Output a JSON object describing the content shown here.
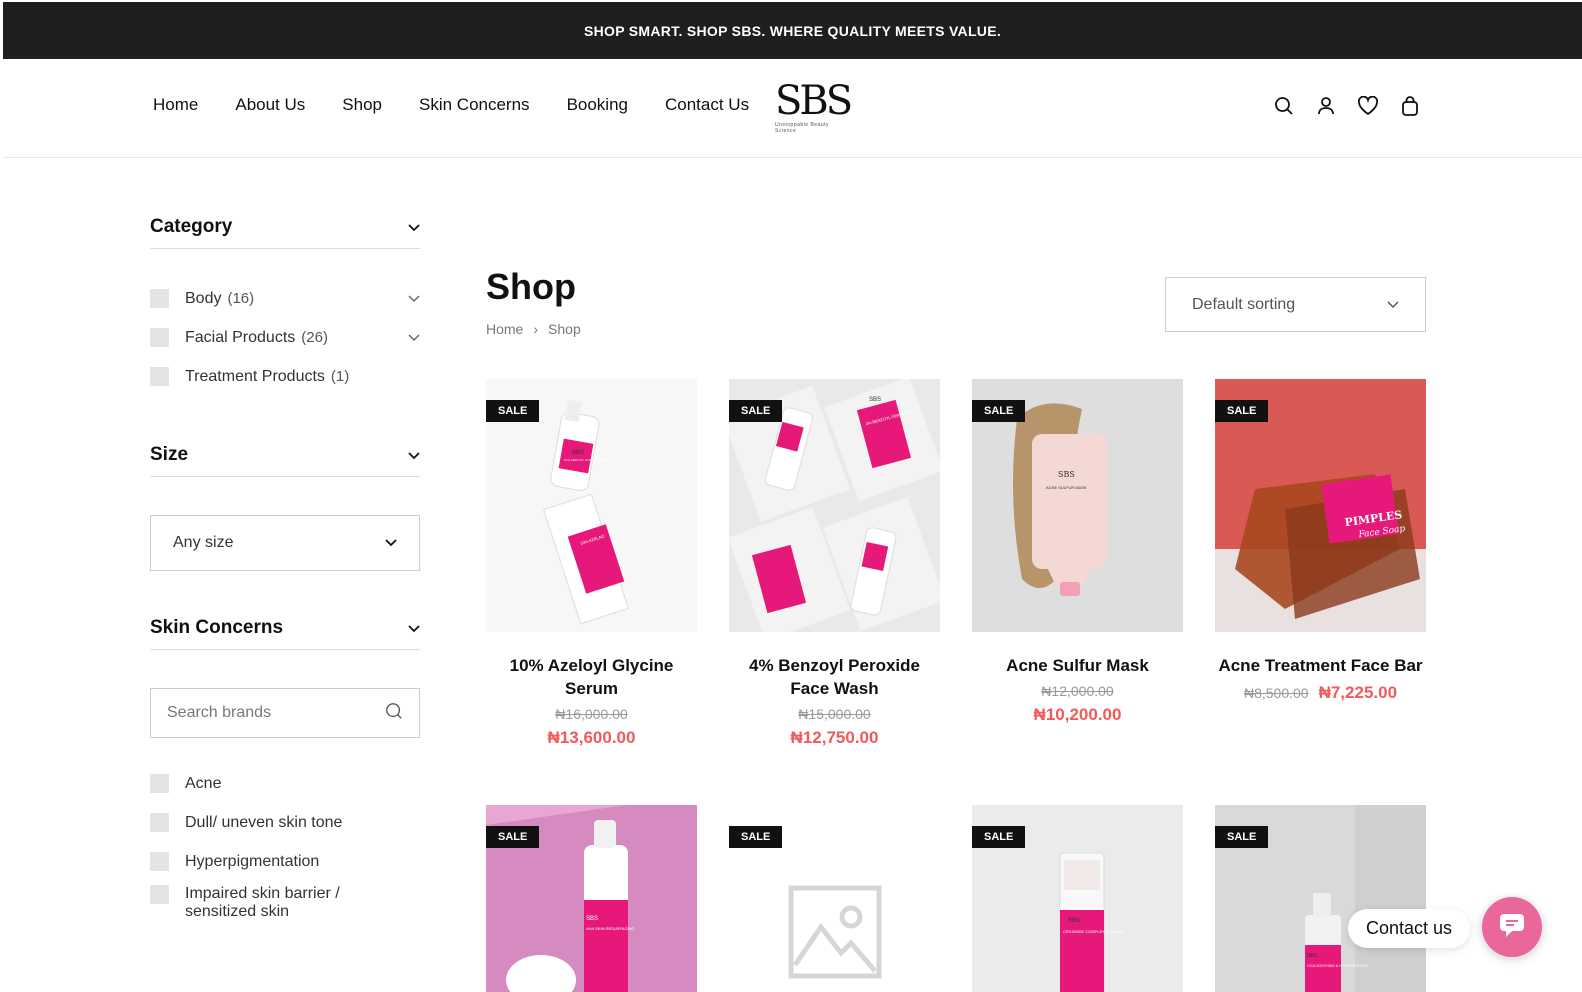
{
  "announcement": "SHOP SMART. SHOP SBS. WHERE QUALITY MEETS VALUE.",
  "nav": [
    "Home",
    "About Us",
    "Shop",
    "Skin Concerns",
    "Booking",
    "Contact Us"
  ],
  "logo": {
    "mark": "SBS",
    "tagline": "Unstoppable Beauty Science"
  },
  "header_icons": [
    "search-icon",
    "user-icon",
    "heart-icon",
    "bag-icon"
  ],
  "sidebar": {
    "category": {
      "title": "Category",
      "items": [
        {
          "label": "Body",
          "count": "(16)"
        },
        {
          "label": "Facial Products",
          "count": "(26)"
        },
        {
          "label": "Treatment Products",
          "count": "(1)"
        }
      ]
    },
    "size": {
      "title": "Size",
      "value": "Any size"
    },
    "skin": {
      "title": "Skin Concerns",
      "search_placeholder": "Search brands",
      "items": [
        "Acne",
        "Dull/ uneven skin tone",
        "Hyperpigmentation",
        "Impaired skin barrier / sensitized skin"
      ]
    }
  },
  "main": {
    "title": "Shop",
    "breadcrumb": [
      "Home",
      "Shop"
    ],
    "sort": "Default sorting"
  },
  "sale_label": "SALE",
  "products": [
    {
      "name": "10% Azeloyl Glycine Serum",
      "old": "₦16,000.00",
      "new": "₦13,600.00"
    },
    {
      "name": "4% Benzoyl Peroxide Face Wash",
      "old": "₦15,000.00",
      "new": "₦12,750.00"
    },
    {
      "name": "Acne Sulfur Mask",
      "old": "₦12,000.00",
      "new": "₦10,200.00"
    },
    {
      "name": "Acne Treatment Face Bar",
      "old": "₦8,500.00",
      "new": "₦7,225.00"
    }
  ],
  "product_labels": {
    "p1a": "SBS",
    "p1b": "10% AZELOYL GLYCINE SERUM",
    "p1c": "10% AZELAIC",
    "p2a": "SBS",
    "p2b": "4% BENZOYL PEROXIDE",
    "p3a": "SBS",
    "p3b": "ACNE SULFUR MASK",
    "p4a": "PIMPLES",
    "p4b": "Face Soap",
    "p5a": "SBS",
    "p5b": "AHA SKIN RESURFACING",
    "p7a": "SBS",
    "p7b": "CERAMIDE COMPLEX ESSENCE",
    "p8a": "SBS",
    "p8b": "CICA SOOTHING & HYDRATING MIST"
  },
  "contact": "Contact us",
  "colors": {
    "accent": "#f25a5a",
    "brand_pink": "#e6197a",
    "dark": "#1f1f1f"
  }
}
